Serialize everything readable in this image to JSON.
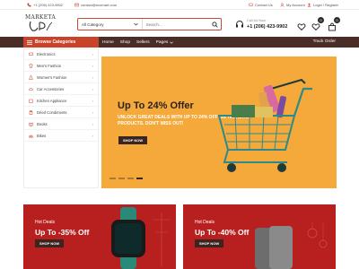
{
  "topbar": {
    "phone": "+1 (206) 423-9802",
    "email": "contact@ecomart.com",
    "contact": "Contact Us",
    "account": "My Account",
    "login": "Login / Register"
  },
  "header": {
    "logo_text": "MARKETA",
    "search": {
      "category": "All Category",
      "placeholder": "Search..."
    },
    "phone_label": "Call Us Now :",
    "phone_number": "+1 (206) 423-9902",
    "wishlist_count": "0",
    "cart_count": "0"
  },
  "nav": {
    "browse_label": "Browse Categories",
    "links": [
      "Home",
      "Shop",
      "Sellers",
      "Pages"
    ],
    "track_order": "Track Order"
  },
  "sidebar": {
    "items": [
      {
        "label": "Electronics"
      },
      {
        "label": "Men's Fashion"
      },
      {
        "label": "Women's Fashion"
      },
      {
        "label": "Car Accessories"
      },
      {
        "label": "Kitchen Appliance"
      },
      {
        "label": "Dried Condiments"
      },
      {
        "label": "Books"
      },
      {
        "label": "Bikes"
      }
    ]
  },
  "hero": {
    "headline": "Up To 24% Offer",
    "subtext": "UNLOCK GREAT DEALS WITH UP TO 24% OFF ON TRENDING PRODUCTS. DON'T MISS OUT!",
    "button": "SHOP NOW",
    "slides_total": 4,
    "active_slide": 4
  },
  "promos": [
    {
      "tag": "Hot Deals",
      "headline": "Up To -35% Off",
      "button": "SHOP NOW"
    },
    {
      "tag": "Hot Deals",
      "headline": "Up To -40% Off",
      "button": "SHOP NOW"
    }
  ],
  "colors": {
    "accent": "#c9432b",
    "nav_bg": "#4a2d26",
    "hero_bg": "#f4a93a",
    "promo_bg": "#b8201f"
  }
}
